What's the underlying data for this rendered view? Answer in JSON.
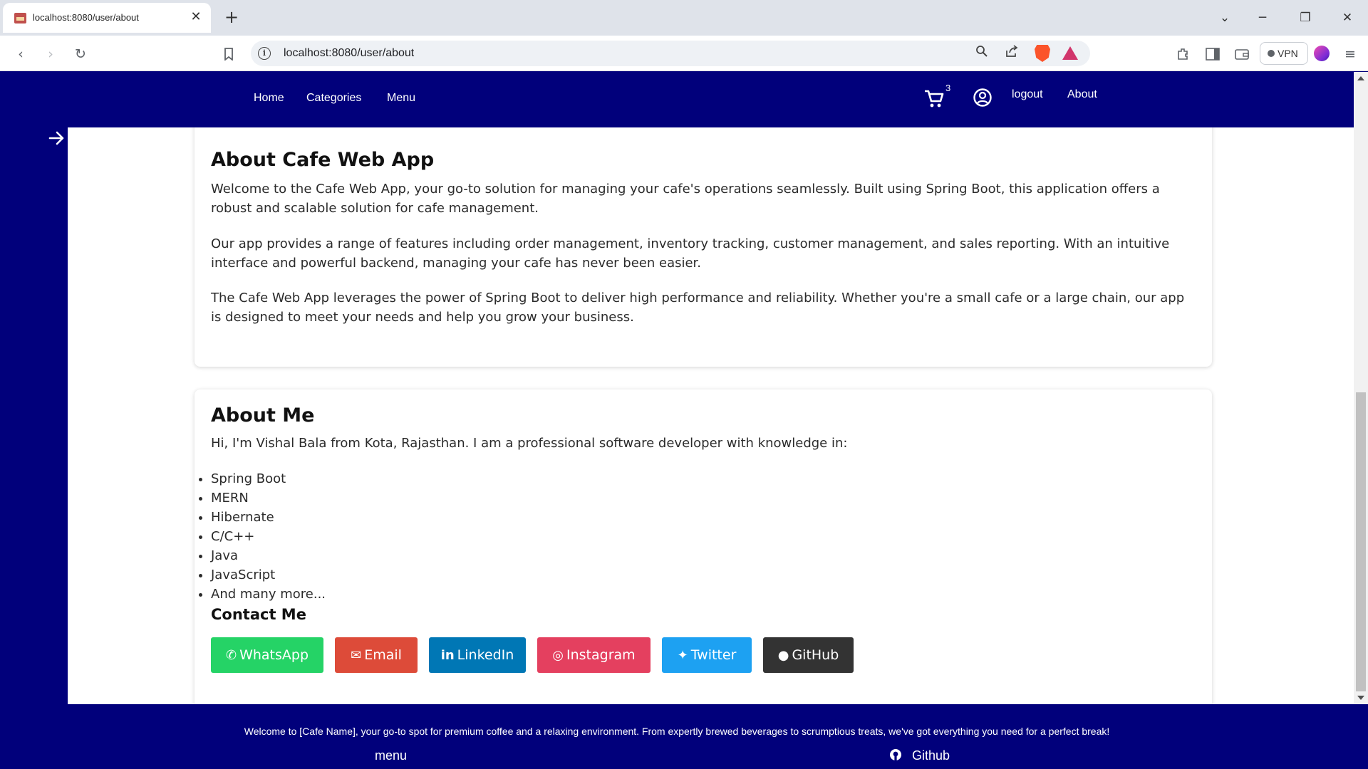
{
  "browser": {
    "tab_title": "localhost:8080/user/about",
    "tab_close": "✕",
    "new_tab": "+",
    "url": "localhost:8080/user/about",
    "vpn_label": "VPN",
    "icons": [
      "back-icon",
      "forward-icon",
      "reload-icon",
      "bookmark-icon",
      "info-icon",
      "zoom-icon",
      "share-icon",
      "brave-shield-icon",
      "brave-rewards-icon",
      "extensions-icon",
      "sidebar-icon",
      "wallet-icon",
      "leo-icon",
      "menu-icon"
    ]
  },
  "nav": {
    "links": [
      "Home",
      "Categories",
      "Menu"
    ],
    "cart_count": "3",
    "logout": "logout",
    "about": "About"
  },
  "about_app": {
    "title": "About Cafe Web App",
    "p1": "Welcome to the Cafe Web App, your go-to solution for managing your cafe's operations seamlessly. Built using Spring Boot, this application offers a robust and scalable solution for cafe management.",
    "p2": "Our app provides a range of features including order management, inventory tracking, customer management, and sales reporting. With an intuitive interface and powerful backend, managing your cafe has never been easier.",
    "p3": "The Cafe Web App leverages the power of Spring Boot to deliver high performance and reliability. Whether you're a small cafe or a large chain, our app is designed to meet your needs and help you grow your business."
  },
  "about_me": {
    "title": "About Me",
    "intro": "Hi, I'm Vishal Bala from Kota, Rajasthan. I am a professional software developer with knowledge in:",
    "skills": [
      "Spring Boot",
      "MERN",
      "Hibernate",
      "C/C++",
      "Java",
      "JavaScript",
      "And many more..."
    ],
    "contact_title": "Contact Me",
    "contacts": [
      {
        "label": "WhatsApp",
        "color": "#25d366"
      },
      {
        "label": "Email",
        "color": "#dd4b39"
      },
      {
        "label": "LinkedIn",
        "color": "#0077b5"
      },
      {
        "label": "Instagram",
        "color": "#e4405f"
      },
      {
        "label": "Twitter",
        "color": "#1da1f2"
      },
      {
        "label": "GitHub",
        "color": "#333333"
      }
    ]
  },
  "footer": {
    "text": "Welcome to [Cafe Name], your go-to spot for premium coffee and a relaxing environment. From expertly brewed beverages to scrumptious treats, we've got everything you need for a perfect break!",
    "menu_link": "menu",
    "github_link": "Github"
  },
  "colors": {
    "brand_navy": "#01007b",
    "page_bg": "#ffffff"
  }
}
